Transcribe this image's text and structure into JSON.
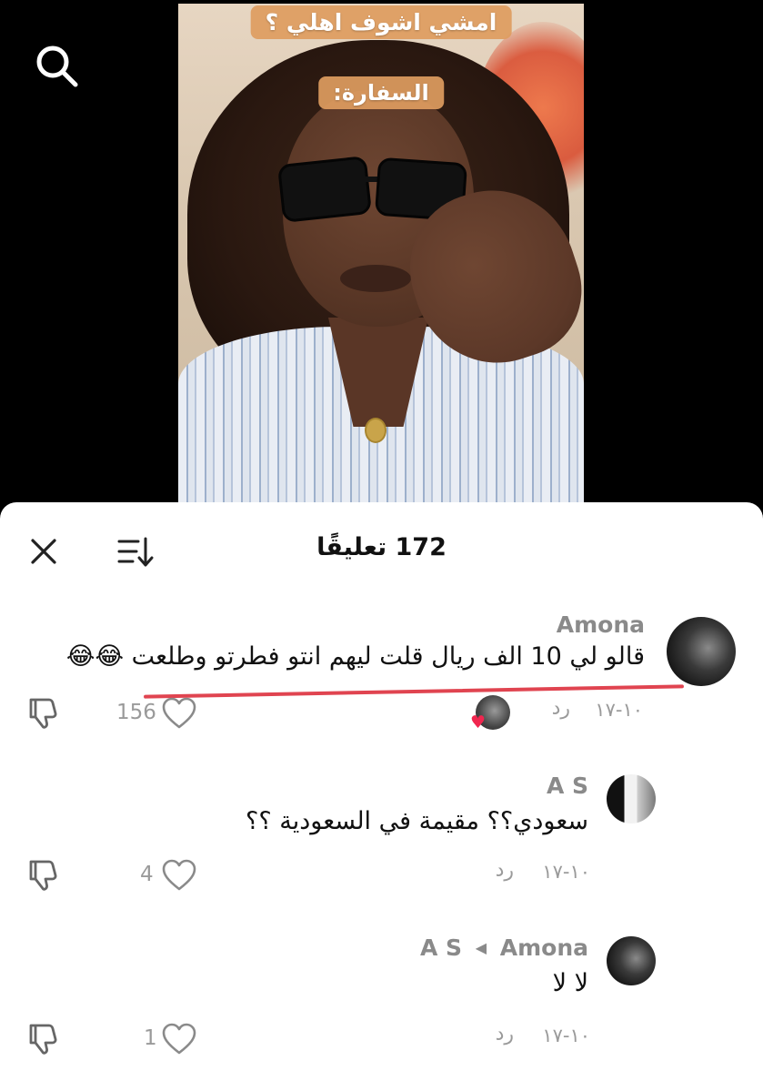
{
  "video": {
    "overlay_top": "امشي اشوف اهلي ؟",
    "overlay_middle": "السفارة:"
  },
  "sheet": {
    "title": "172 تعليقًا"
  },
  "comments": [
    {
      "username": "Amona",
      "text": "قالو لي 10 الف ريال قلت ليهم انتو فطرتو وطلعت 😂😂",
      "date": "١٠-١٧",
      "reply_label": "رد",
      "likes": "156",
      "liked_by_creator": true
    },
    {
      "username": "A S",
      "text": "سعودي؟؟ مقيمة في السعودية ؟؟",
      "date": "١٠-١٧",
      "reply_label": "رد",
      "likes": "4"
    },
    {
      "username": "Amona",
      "reply_to": "A S",
      "text": "لا لا",
      "date": "١٠-١٧",
      "reply_label": "رد",
      "likes": "1"
    }
  ],
  "colors": {
    "accent_heart": "#f0264f",
    "annotation_line": "#e04450",
    "muted_text": "#9a9a9a"
  },
  "icons": {
    "search": "search-icon",
    "close": "close-icon",
    "sort": "sort-icon",
    "like": "heart-icon",
    "dislike": "thumbs-down-icon"
  }
}
